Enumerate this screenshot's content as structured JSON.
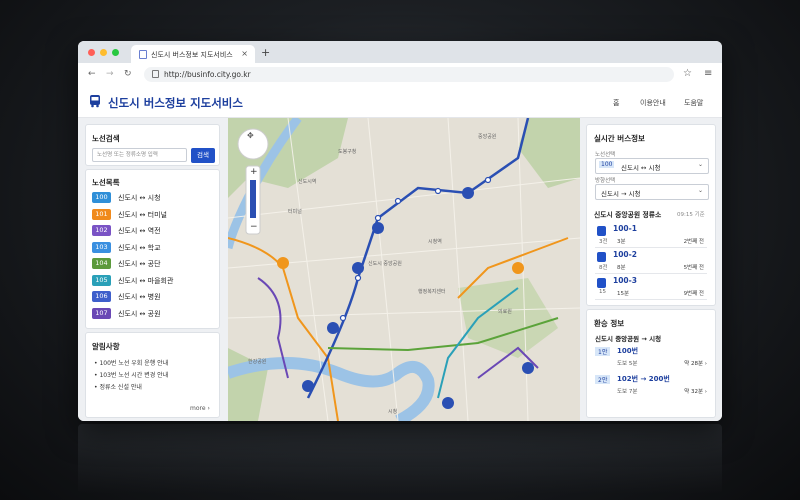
{
  "browser": {
    "tab_title": "신도시 버스정보 지도서비스",
    "tab_close": "×",
    "new_tab": "+",
    "url": "http://businfo.city.go.kr"
  },
  "app": {
    "title": "신도시 버스정보 지도서비스",
    "nav": [
      "홈",
      "이용안내",
      "도움말"
    ]
  },
  "search": {
    "title": "노선검색",
    "placeholder": "노선명 또는 정류소명 입력",
    "button": "검색"
  },
  "routes": {
    "title": "노선목록",
    "items": [
      {
        "no": "100",
        "name": "신도시 ↔ 시청",
        "color": "#2f8fd8"
      },
      {
        "no": "101",
        "name": "신도시 ↔ 터미널",
        "color": "#f08a1c"
      },
      {
        "no": "102",
        "name": "신도시 ↔ 역전",
        "color": "#7a53c5"
      },
      {
        "no": "103",
        "name": "신도시 ↔ 학교",
        "color": "#3a8fe0"
      },
      {
        "no": "104",
        "name": "신도시 ↔ 공단",
        "color": "#5c9a3c"
      },
      {
        "no": "105",
        "name": "신도시 ↔ 마을회관",
        "color": "#2aa0b8"
      },
      {
        "no": "106",
        "name": "신도시 ↔ 병원",
        "color": "#3e5fcb"
      },
      {
        "no": "107",
        "name": "신도시 ↔ 공원",
        "color": "#6a48b5"
      }
    ]
  },
  "notices": {
    "title": "알림사항",
    "items": [
      "100번 노선 우회 운행 안내",
      "103번 노선 시간 변경 안내",
      "정류소 신설 안내"
    ],
    "more": "more ›"
  },
  "realtime": {
    "title": "실시간 버스정보",
    "route_label": "노선선택",
    "route_no": "100",
    "route_value": "신도시 ↔ 시청",
    "dir_label": "방향선택",
    "dir_value": "신도시 → 시청",
    "stop_title": "신도시 중앙공원 정류소",
    "stop_time": "09:15 기준",
    "arrivals": [
      {
        "route": "100-1",
        "stops": "3전",
        "time": "3분",
        "pos": "2번째 전"
      },
      {
        "route": "100-2",
        "stops": "8전",
        "time": "8분",
        "pos": "5번째 전"
      },
      {
        "route": "100-3",
        "stops": "15",
        "time": "15분",
        "pos": "9번째 전"
      }
    ]
  },
  "transfer": {
    "title": "환승 정보",
    "path": "신도시 중앙공원 → 시청",
    "options": [
      {
        "tag": "1안",
        "route": "100번",
        "walk": "도보 5분",
        "total": "약 28분 ›"
      },
      {
        "tag": "2안",
        "route": "102번 → 200번",
        "walk": "도보 7분",
        "total": "약 32분 ›"
      }
    ]
  },
  "map": {
    "labels": [
      "도봉구청",
      "중앙공원",
      "시청역",
      "신도시 중앙공원",
      "터미널",
      "시청",
      "한강공원",
      "행정복지센터",
      "신도시역",
      "의료원"
    ],
    "zoom_in": "+",
    "zoom_out": "−"
  }
}
